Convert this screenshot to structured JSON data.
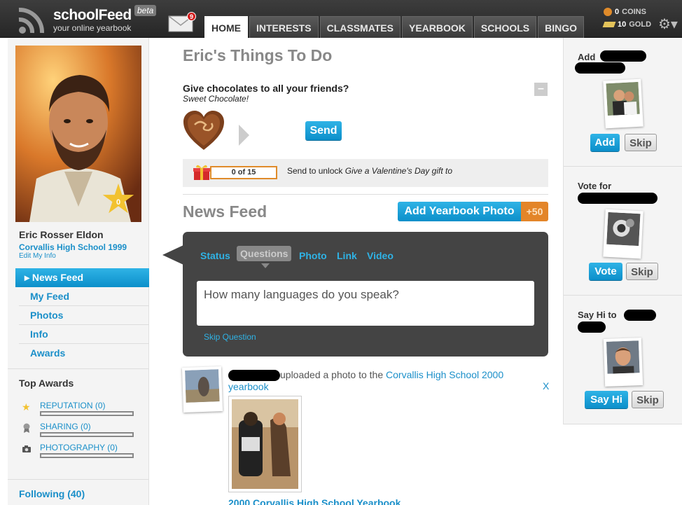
{
  "header": {
    "logo_name": "schoolFeed",
    "logo_beta": "beta",
    "logo_tagline": "your online yearbook",
    "mail_count": "9",
    "tabs": [
      "HOME",
      "INTERESTS",
      "CLASSMATES",
      "YEARBOOK",
      "SCHOOLS",
      "BINGO"
    ],
    "active_tab": "HOME",
    "coins_value": "0",
    "coins_label": "COINS",
    "gold_value": "10",
    "gold_label": "GOLD",
    "settings_icon": "gear-icon"
  },
  "profile": {
    "star_count": "0",
    "name": "Eric Rosser Eldon",
    "school": "Corvallis High School 1999",
    "edit_link": "Edit My Info"
  },
  "nav": {
    "items": [
      "News Feed",
      "My Feed",
      "Photos",
      "Info",
      "Awards"
    ],
    "active": "News Feed"
  },
  "awards": {
    "title": "Top Awards",
    "items": [
      {
        "label": "REPUTATION (0)",
        "icon": "star-icon",
        "progress": 0
      },
      {
        "label": "SHARING (0)",
        "icon": "ribbon-icon",
        "progress": 0
      },
      {
        "label": "PHOTOGRAPHY (0)",
        "icon": "camera-icon",
        "progress": 0
      }
    ]
  },
  "following": "Following (40)",
  "todo": {
    "title": "Eric's Things To Do",
    "task_title": "Give chocolates to all your friends?",
    "task_subtitle": "Sweet Chocolate!",
    "collapse_label": "–",
    "send_label": "Send",
    "progress_text": "0 of 15",
    "unlock_prefix": "Send to unlock ",
    "unlock_item": "Give a Valentine's Day gift to"
  },
  "news_feed": {
    "title": "News Feed",
    "add_photo_label": "Add Yearbook Photo",
    "add_photo_bonus": "+50",
    "composer_tabs": [
      "Status",
      "Questions",
      "Photo",
      "Link",
      "Video"
    ],
    "composer_active": "Questions",
    "question_text": "How many languages do you speak?",
    "skip_label": "Skip Question",
    "item": {
      "action_text": "uploaded a photo to the ",
      "target_link": "Corvallis High School 2000 yearbook",
      "close_label": "X",
      "caption": "2000 Corvallis High School Yearbook"
    }
  },
  "right": {
    "add_section": {
      "label": "Add",
      "button": "Add",
      "skip": "Skip"
    },
    "vote_section": {
      "label": "Vote for",
      "button": "Vote",
      "skip": "Skip"
    },
    "hi_section": {
      "label": "Say Hi to",
      "button": "Say Hi",
      "skip": "Skip"
    }
  }
}
